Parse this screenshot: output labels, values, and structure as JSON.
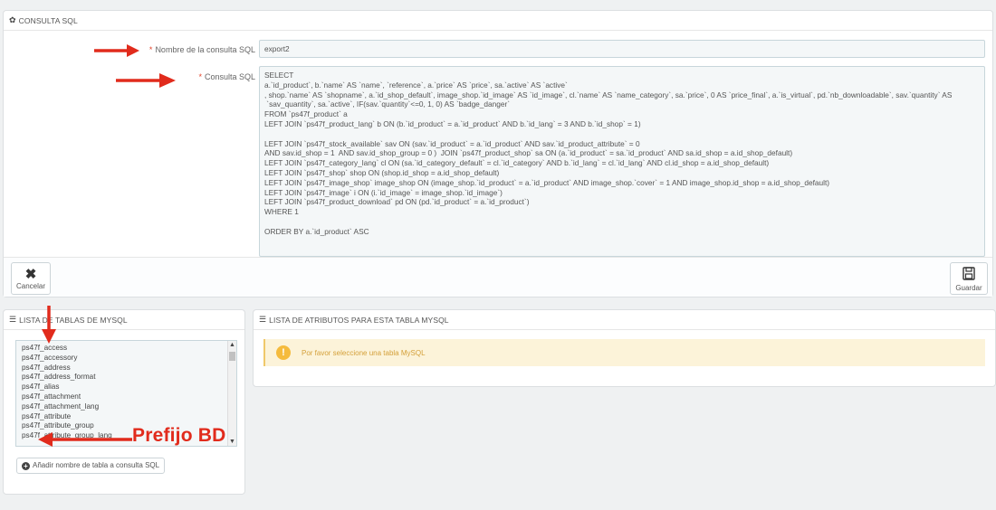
{
  "main_panel": {
    "title": "CONSULTA SQL",
    "name_label": "Nombre de la consulta SQL",
    "name_value": "export2",
    "sql_label": "Consulta SQL",
    "sql_value": "SELECT\na.`id_product`, b.`name` AS `name`, `reference`, a.`price` AS `price`, sa.`active` AS `active`\n, shop.`name` AS `shopname`, a.`id_shop_default`, image_shop.`id_image` AS `id_image`, cl.`name` AS `name_category`, sa.`price`, 0 AS `price_final`, a.`is_virtual`, pd.`nb_downloadable`, sav.`quantity` AS\n `sav_quantity`, sa.`active`, IF(sav.`quantity`<=0, 1, 0) AS `badge_danger`\nFROM `ps47f_product` a\nLEFT JOIN `ps47f_product_lang` b ON (b.`id_product` = a.`id_product` AND b.`id_lang` = 3 AND b.`id_shop` = 1)\n\nLEFT JOIN `ps47f_stock_available` sav ON (sav.`id_product` = a.`id_product` AND sav.`id_product_attribute` = 0\nAND sav.id_shop = 1  AND sav.id_shop_group = 0 )  JOIN `ps47f_product_shop` sa ON (a.`id_product` = sa.`id_product` AND sa.id_shop = a.id_shop_default)\nLEFT JOIN `ps47f_category_lang` cl ON (sa.`id_category_default` = cl.`id_category` AND b.`id_lang` = cl.`id_lang` AND cl.id_shop = a.id_shop_default)\nLEFT JOIN `ps47f_shop` shop ON (shop.id_shop = a.id_shop_default)\nLEFT JOIN `ps47f_image_shop` image_shop ON (image_shop.`id_product` = a.`id_product` AND image_shop.`cover` = 1 AND image_shop.id_shop = a.id_shop_default)\nLEFT JOIN `ps47f_image` i ON (i.`id_image` = image_shop.`id_image`)\nLEFT JOIN `ps47f_product_download` pd ON (pd.`id_product` = a.`id_product`)\nWHERE 1\n\nORDER BY a.`id_product` ASC",
    "cancel_label": "Cancelar",
    "save_label": "Guardar",
    "required_mark": "*"
  },
  "tables_panel": {
    "title": "LISTA DE TABLAS DE MYSQL",
    "tables": [
      "ps47f_access",
      "ps47f_accessory",
      "ps47f_address",
      "ps47f_address_format",
      "ps47f_alias",
      "ps47f_attachment",
      "ps47f_attachment_lang",
      "ps47f_attribute",
      "ps47f_attribute_group",
      "ps47f_attribute_group_lang"
    ],
    "add_button_label": "Añadir nombre de tabla a consulta SQL"
  },
  "attributes_panel": {
    "title": "LISTA DE ATRIBUTOS PARA ESTA TABLA MYSQL",
    "alert_text": "Por favor seleccione una tabla MySQL"
  },
  "annotation": {
    "text": "Prefijo BD",
    "color": "#e12b1c"
  },
  "icons": {
    "panel_icon": "gear-icon",
    "list_icon": "list-icon",
    "cancel_icon": "close-icon",
    "save_icon": "floppy-disk-icon",
    "add_icon": "plus-circle-icon",
    "alert_icon": "warning-icon"
  }
}
